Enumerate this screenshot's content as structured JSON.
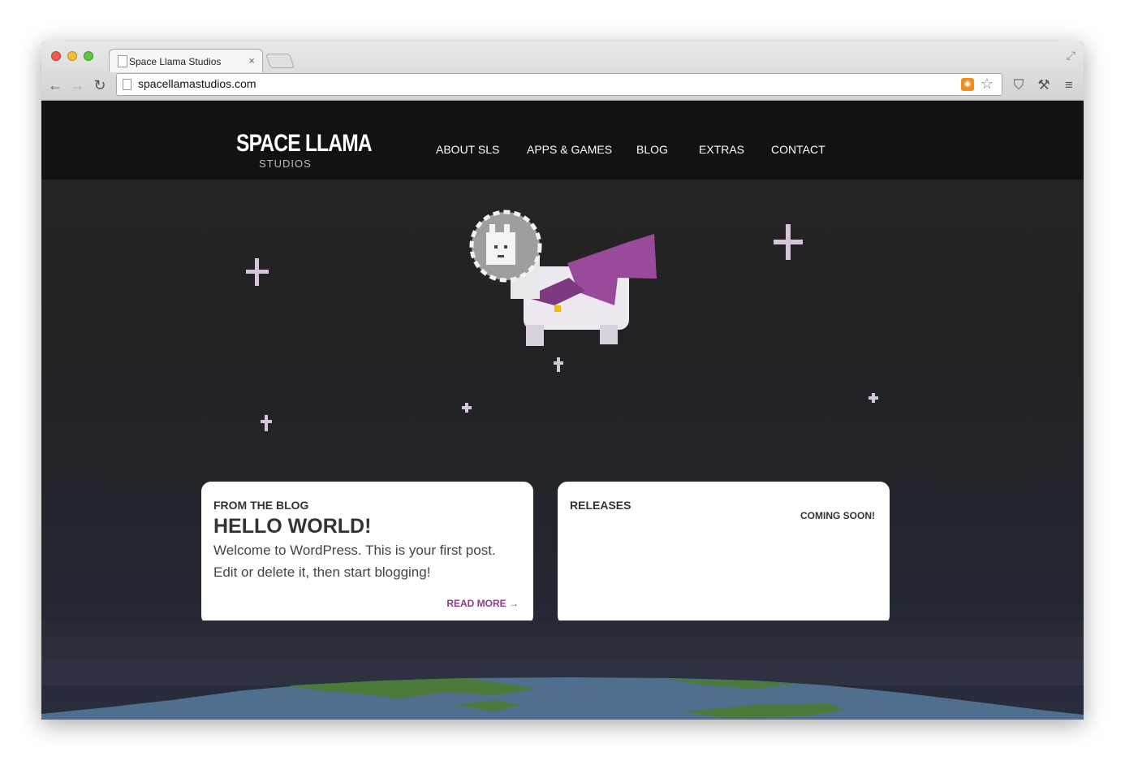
{
  "browser": {
    "tab_title": "Space Llama Studios",
    "tab_close": "×",
    "url": "spacellamastudios.com",
    "icons": {
      "back": "←",
      "forward": "→",
      "reload": "↻",
      "star": "☆",
      "rss": "◉",
      "pocket": "⛉",
      "wrench": "⚒",
      "menu": "≡",
      "fullscreen": "⤢"
    }
  },
  "site": {
    "logo_main": "SPACE LLAMA",
    "logo_sub": "STUDIOS",
    "nav": [
      "ABOUT SLS",
      "APPS & GAMES",
      "BLOG",
      "EXTRAS",
      "CONTACT"
    ]
  },
  "blog_card": {
    "heading": "FROM THE BLOG",
    "title": "HELLO WORLD!",
    "text": "Welcome to WordPress. This is your first post. Edit or delete it, then start blogging!",
    "link": "READ MORE →"
  },
  "releases_card": {
    "heading": "RELEASES",
    "status": "COMING SOON!"
  },
  "colors": {
    "accent": "#8e3a8a",
    "cape": "#9a4a9a",
    "earth_water": "#4f6f8f",
    "earth_land": "#4b7a3a"
  }
}
